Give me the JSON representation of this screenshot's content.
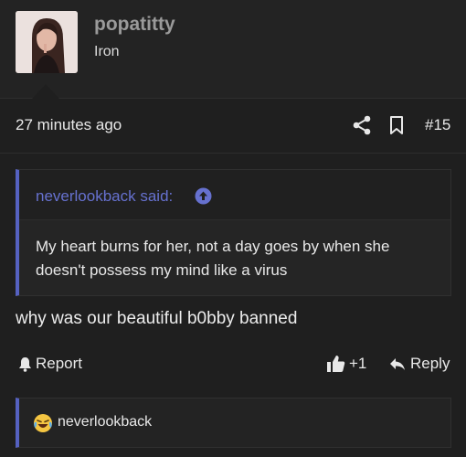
{
  "post": {
    "author": "popatitty",
    "author_title": "Iron",
    "avatar_icon": "user-avatar-photo",
    "timestamp": "27 minutes ago",
    "post_number": "#15",
    "quote": {
      "author_label": "neverlookback said:",
      "text": "My heart burns for her, not a day goes by when she doesn't possess my mind like a virus"
    },
    "message": "why was our beautiful b0bby banned",
    "actions": {
      "report_label": "Report",
      "like_label": "+1",
      "reply_label": "Reply"
    },
    "reactions": {
      "emoji": "laughing-crying-face",
      "users": "neverlookback"
    }
  },
  "colors": {
    "background": "#1f1f1f",
    "accent": "#5561c0",
    "link": "#6671cf",
    "username": "#9a9a9a"
  }
}
